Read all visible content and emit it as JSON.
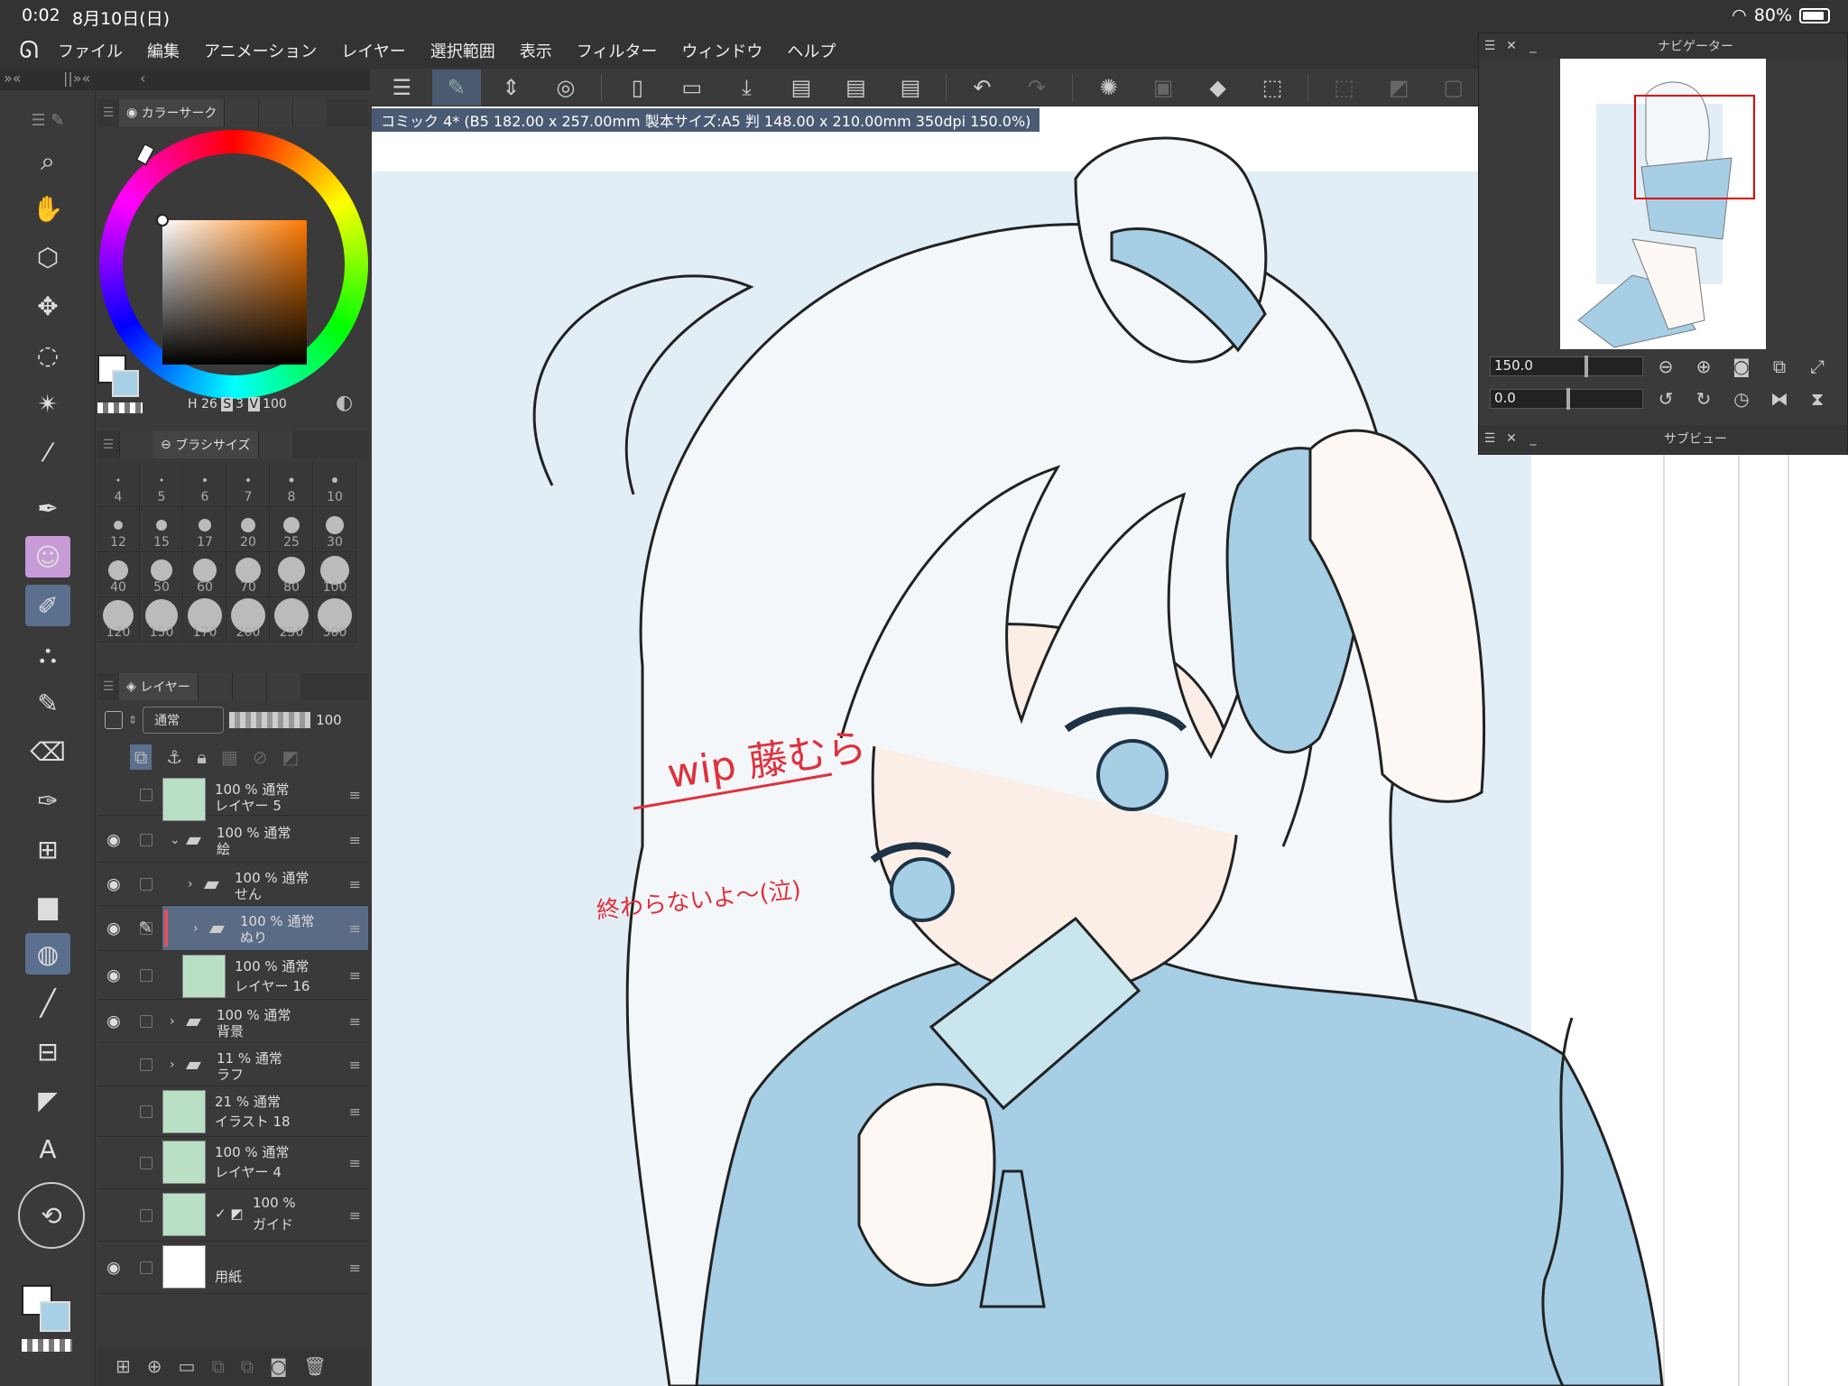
{
  "status": {
    "time": "0:02",
    "date": "8月10日(日)",
    "battery": "80%"
  },
  "menu": [
    "ファイル",
    "編集",
    "アニメーション",
    "レイヤー",
    "選択範囲",
    "表示",
    "フィルター",
    "ウィンドウ",
    "ヘルプ"
  ],
  "document_tab": "コミック 4* (B5 182.00 x 257.00mm 製本サイズ:A5 判 148.00 x 210.00mm 350dpi 150.0%)",
  "color_panel": {
    "title": "カラーサーク",
    "h_label": "H",
    "h": "26",
    "s_label": "S",
    "s": "3",
    "v_label": "V",
    "v": "100",
    "main_color": "#ffffff",
    "sub_color": "#a8d0e6"
  },
  "brush_panel": {
    "title": "ブラシサイズ",
    "sizes": [
      "4",
      "5",
      "6",
      "7",
      "8",
      "10",
      "12",
      "15",
      "17",
      "20",
      "25",
      "30",
      "40",
      "50",
      "60",
      "70",
      "80",
      "100",
      "120",
      "150",
      "170",
      "200",
      "250",
      "300"
    ]
  },
  "layer_panel": {
    "title": "レイヤー",
    "blend_mode": "通常",
    "opacity": "100",
    "layers": [
      {
        "opacity": "100 % 通常",
        "name": "レイヤー 5"
      },
      {
        "opacity": "100 % 通常",
        "name": "絵"
      },
      {
        "opacity": "100 % 通常",
        "name": "せん"
      },
      {
        "opacity": "100 % 通常",
        "name": "ぬり"
      },
      {
        "opacity": "100 % 通常",
        "name": "レイヤー 16"
      },
      {
        "opacity": "100 % 通常",
        "name": "背景"
      },
      {
        "opacity": "11 % 通常",
        "name": "ラフ"
      },
      {
        "opacity": "21 % 通常",
        "name": "イラスト 18"
      },
      {
        "opacity": "100 % 通常",
        "name": "レイヤー 4"
      },
      {
        "opacity": "100 %",
        "name": "ガイド"
      },
      {
        "opacity": "",
        "name": "用紙"
      }
    ]
  },
  "navigator": {
    "title": "ナビゲーター",
    "zoom": "150.0",
    "rotation": "0.0",
    "subview_title": "サブビュー"
  },
  "canvas": {
    "annotation_wip": "wip 藤むら",
    "annotation_note": "終わらないよ〜(泣)"
  },
  "icons": {
    "app_logo": "clip-studio-logo",
    "eye": "eye-icon",
    "folder": "folder-icon"
  }
}
